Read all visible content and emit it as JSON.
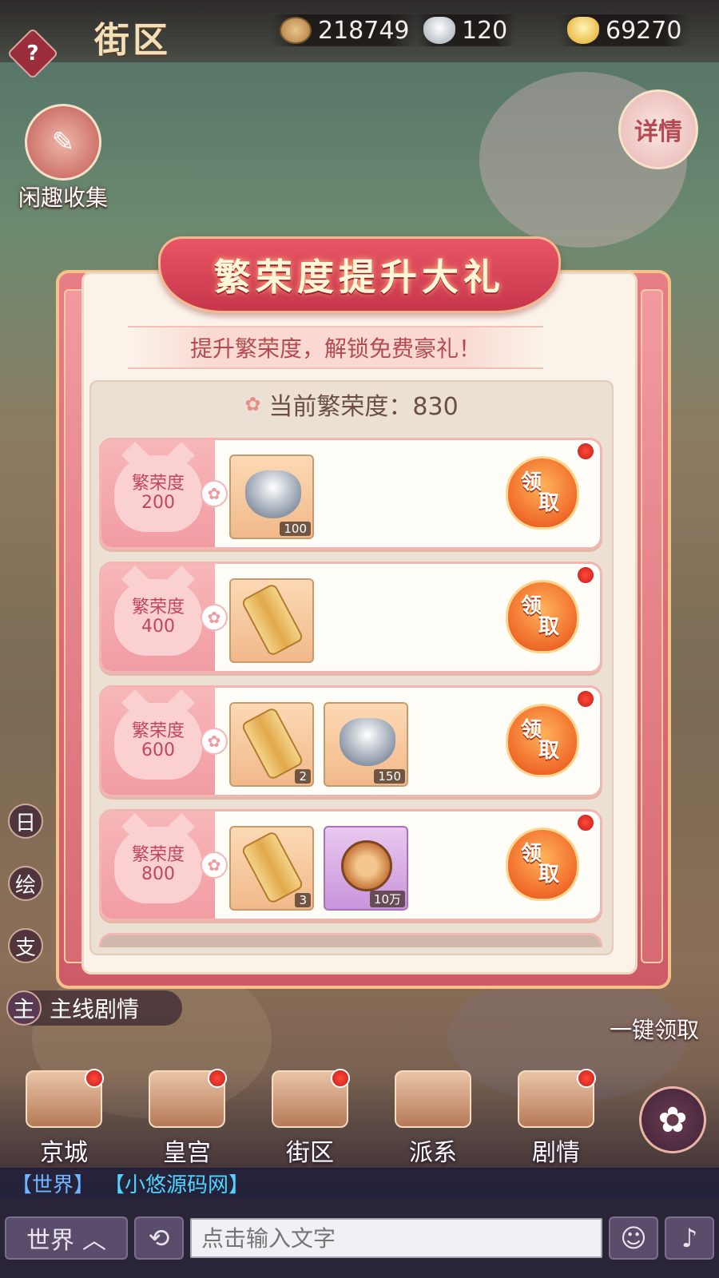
{
  "header": {
    "area_title": "街区",
    "help_symbol": "?",
    "currencies": [
      {
        "icon": "prosperity-coin-icon",
        "value": "218749"
      },
      {
        "icon": "silver-ingot-icon",
        "value": "120"
      },
      {
        "icon": "gold-ingot-icon",
        "value": "69270"
      }
    ]
  },
  "side": {
    "collect_label": "闲趣收集",
    "details_label": "详情",
    "left_pills": [
      "日",
      "绘",
      "支"
    ],
    "quest_icon": "主",
    "quest_label": "主线剧情",
    "claim_all_label": "一键领取"
  },
  "dialog": {
    "title": "繁荣度提升大礼",
    "subtitle": "提升繁荣度，解锁免费豪礼！",
    "current_label": "当前繁荣度：830",
    "tier_label": "繁荣度",
    "claim_top": "领",
    "claim_bottom": "取",
    "tiers": [
      {
        "threshold": "200",
        "rewards": [
          {
            "icon": "silver-ingot-icon",
            "count": "100"
          }
        ]
      },
      {
        "threshold": "400",
        "rewards": [
          {
            "icon": "token-icon",
            "count": ""
          }
        ]
      },
      {
        "threshold": "600",
        "rewards": [
          {
            "icon": "token-icon",
            "count": "2"
          },
          {
            "icon": "silver-ingot-icon",
            "count": "150"
          }
        ]
      },
      {
        "threshold": "800",
        "rewards": [
          {
            "icon": "token-icon",
            "count": "3"
          },
          {
            "icon": "copper-coins-icon",
            "count": "10万"
          }
        ]
      }
    ]
  },
  "nav": {
    "items": [
      "京城",
      "皇宫",
      "街区",
      "派系",
      "剧情"
    ]
  },
  "chat": {
    "channel_tag": "【世界】",
    "sender": "【小悠源码网】",
    "channel_button": "世界",
    "input_placeholder": "点击输入文字"
  }
}
